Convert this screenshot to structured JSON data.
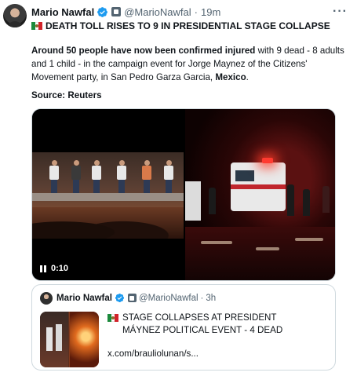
{
  "tweet": {
    "author_name": "Mario Nawfal",
    "handle": "@MarioNawfal",
    "separator": "·",
    "time": "19m",
    "more": "···",
    "headline": "DEATH TOLL RISES TO 9 IN PRESIDENTIAL STAGE COLLAPSE",
    "body": {
      "p1_bold": "Around 50 people have now been confirmed injured",
      "p1_rest": " with 9 dead - 8 adults and 1 child - in the campaign event for Jorge Maynez of the Citizens' Movement party, in San Pedro Garza Garcia, ",
      "p1_bold_end": "Mexico",
      "p1_end": "."
    },
    "source": "Source: Reuters",
    "video": {
      "timestamp": "0:10"
    }
  },
  "quoted_tweet": {
    "author_name": "Mario Nawfal",
    "handle": "@MarioNawfal",
    "separator": "·",
    "time": "3h",
    "text": "STAGE COLLAPSES AT  PRESIDENT MÁYNEZ POLITICAL EVENT - 4 DEAD",
    "link": "x.com/brauliolunan/s..."
  },
  "icons": [
    "verified-badge-icon",
    "affiliate-badge-icon",
    "mexico-flag-icon",
    "pause-icon",
    "more-icon"
  ],
  "colors": {
    "verified": "#1d9bf0",
    "text": "#0f1419",
    "muted": "#536471",
    "border": "#cfd9de"
  }
}
